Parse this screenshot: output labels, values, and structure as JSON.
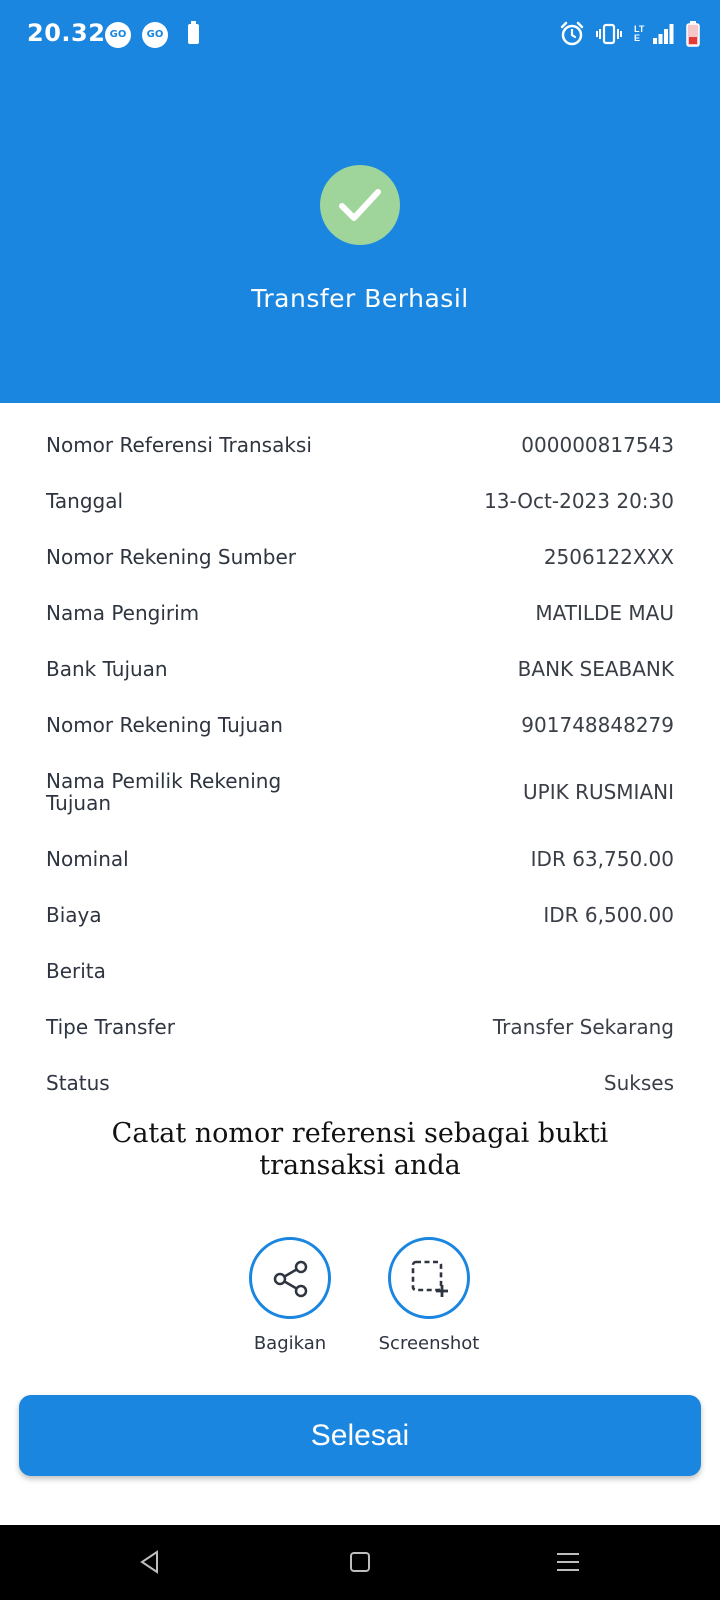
{
  "status_bar": {
    "time": "20.32",
    "badges": [
      "GO",
      "GO"
    ],
    "network": "LTE",
    "icons": [
      "alarm-icon",
      "vibrate-icon",
      "signal-icon",
      "battery-icon"
    ]
  },
  "header": {
    "title": "Transfer Berhasil",
    "icon": "check-icon",
    "check_color": "#9fd49a",
    "background": "#1a86e0"
  },
  "details": [
    {
      "label": "Nomor Referensi Transaksi",
      "value": "000000817543"
    },
    {
      "label": "Tanggal",
      "value": "13-Oct-2023 20:30"
    },
    {
      "label": "Nomor Rekening Sumber",
      "value": "2506122XXX"
    },
    {
      "label": "Nama Pengirim",
      "value": "MATILDE MAU"
    },
    {
      "label": "Bank Tujuan",
      "value": "BANK SEABANK"
    },
    {
      "label": "Nomor Rekening Tujuan",
      "value": "901748848279"
    },
    {
      "label": "Nama Pemilik Rekening Tujuan",
      "value": "UPIK RUSMIANI"
    },
    {
      "label": "Nominal",
      "value": "IDR 63,750.00"
    },
    {
      "label": "Biaya",
      "value": "IDR 6,500.00"
    },
    {
      "label": "Berita",
      "value": ""
    },
    {
      "label": "Tipe Transfer",
      "value": "Transfer Sekarang"
    },
    {
      "label": "Status",
      "value": "Sukses"
    }
  ],
  "note": "Catat nomor referensi sebagai bukti transaksi anda",
  "actions": {
    "share_label": "Bagikan",
    "share_icon": "share-icon",
    "screenshot_label": "Screenshot",
    "screenshot_icon": "screenshot-icon"
  },
  "done_button": "Selesai",
  "nav": {
    "back": "back-icon",
    "home": "home-icon",
    "menu": "menu-icon"
  }
}
